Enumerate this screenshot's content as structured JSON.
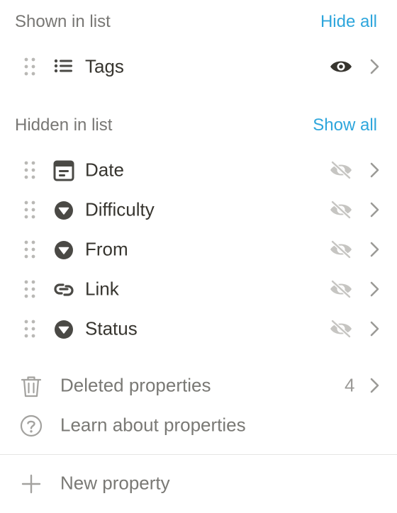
{
  "shown": {
    "title": "Shown in list",
    "action": "Hide all",
    "items": [
      {
        "label": "Tags",
        "type_icon": "list-icon",
        "visibility": "visible"
      }
    ]
  },
  "hidden": {
    "title": "Hidden in list",
    "action": "Show all",
    "items": [
      {
        "label": "Date",
        "type_icon": "calendar-icon",
        "visibility": "hidden"
      },
      {
        "label": "Difficulty",
        "type_icon": "select-icon",
        "visibility": "hidden"
      },
      {
        "label": "From",
        "type_icon": "select-icon",
        "visibility": "hidden"
      },
      {
        "label": "Link",
        "type_icon": "link-icon",
        "visibility": "hidden"
      },
      {
        "label": "Status",
        "type_icon": "select-icon",
        "visibility": "hidden"
      }
    ]
  },
  "deleted": {
    "label": "Deleted properties",
    "count": "4",
    "icon": "trash-icon"
  },
  "learn": {
    "label": "Learn about properties",
    "icon": "question-icon"
  },
  "new_property": {
    "label": "New property",
    "icon": "plus-icon"
  },
  "colors": {
    "accent": "#2ea6dc",
    "text": "#37352f",
    "muted": "#787774",
    "icon_dark": "#4a4945"
  }
}
